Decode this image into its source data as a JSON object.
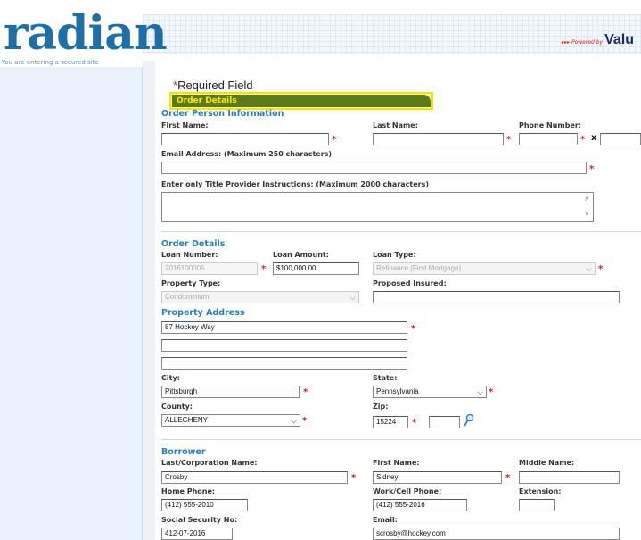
{
  "brand": {
    "logo_text": "radian",
    "secure_text": "You are entering a secured site",
    "powered_small": "▸▸▸ Powered by",
    "powered_brand": "Valu"
  },
  "form": {
    "required_star": "*",
    "required_text": "Required Field",
    "section_title": "Order Details",
    "order_person": {
      "heading": "Order Person Information",
      "first_name_label": "First Name:",
      "first_name_value": "",
      "last_name_label": "Last Name:",
      "last_name_value": "",
      "phone_label": "Phone Number:",
      "phone_value": "",
      "phone_ext_sep": "x",
      "email_label": "Email Address: (Maximum 250 characters)",
      "email_value": "",
      "instructions_label": "Enter only Title Provider Instructions: (Maximum 2000 characters)"
    },
    "order_details": {
      "heading": "Order Details",
      "loan_number_label": "Loan Number:",
      "loan_number_value": "2016100005",
      "loan_amount_label": "Loan Amount:",
      "loan_amount_value": "$100,000.00",
      "loan_type_label": "Loan Type:",
      "loan_type_value": "Refinance (First Mortgage)",
      "property_type_label": "Property Type:",
      "property_type_value": "Condominium",
      "proposed_insured_label": "Proposed Insured:",
      "proposed_insured_value": ""
    },
    "property_address": {
      "heading": "Property Address",
      "line1": "87 Hockey Way",
      "line2": "",
      "line3": "",
      "city_label": "City:",
      "city_value": "Pittsburgh",
      "state_label": "State:",
      "state_value": "Pennsylvania",
      "county_label": "County:",
      "county_value": "ALLEGHENY",
      "zip_label": "Zip:",
      "zip_value": "15224",
      "zip_ext_value": ""
    },
    "borrower": {
      "heading": "Borrower",
      "last_name_label": "Last/Corporation Name:",
      "last_name_value": "Crosby",
      "first_name_label": "First Name:",
      "first_name_value": "Sidney",
      "middle_name_label": "Middle Name:",
      "middle_name_value": "",
      "home_phone_label": "Home Phone:",
      "home_phone_value": "(412) 555-2010",
      "work_phone_label": "Work/Cell Phone:",
      "work_phone_value": "(412) 555-2016",
      "extension_label": "Extension:",
      "extension_value": "",
      "ssn_label": "Social Security No:",
      "ssn_value": "412-07-2016",
      "email_label": "Email:",
      "email_value": "scrosby@hockey.com"
    }
  },
  "icons": {
    "chevron": "⌵",
    "magnifier": "magnifier-icon",
    "scroll_up": "∧",
    "scroll_down": "∨"
  },
  "colors": {
    "brand_blue": "#1d6fa8",
    "heading_blue": "#2b7bbf",
    "required_red": "#d21",
    "section_green": "#5b7a1a",
    "section_text": "#ffe800",
    "highlight_yellow": "#f5e300"
  }
}
